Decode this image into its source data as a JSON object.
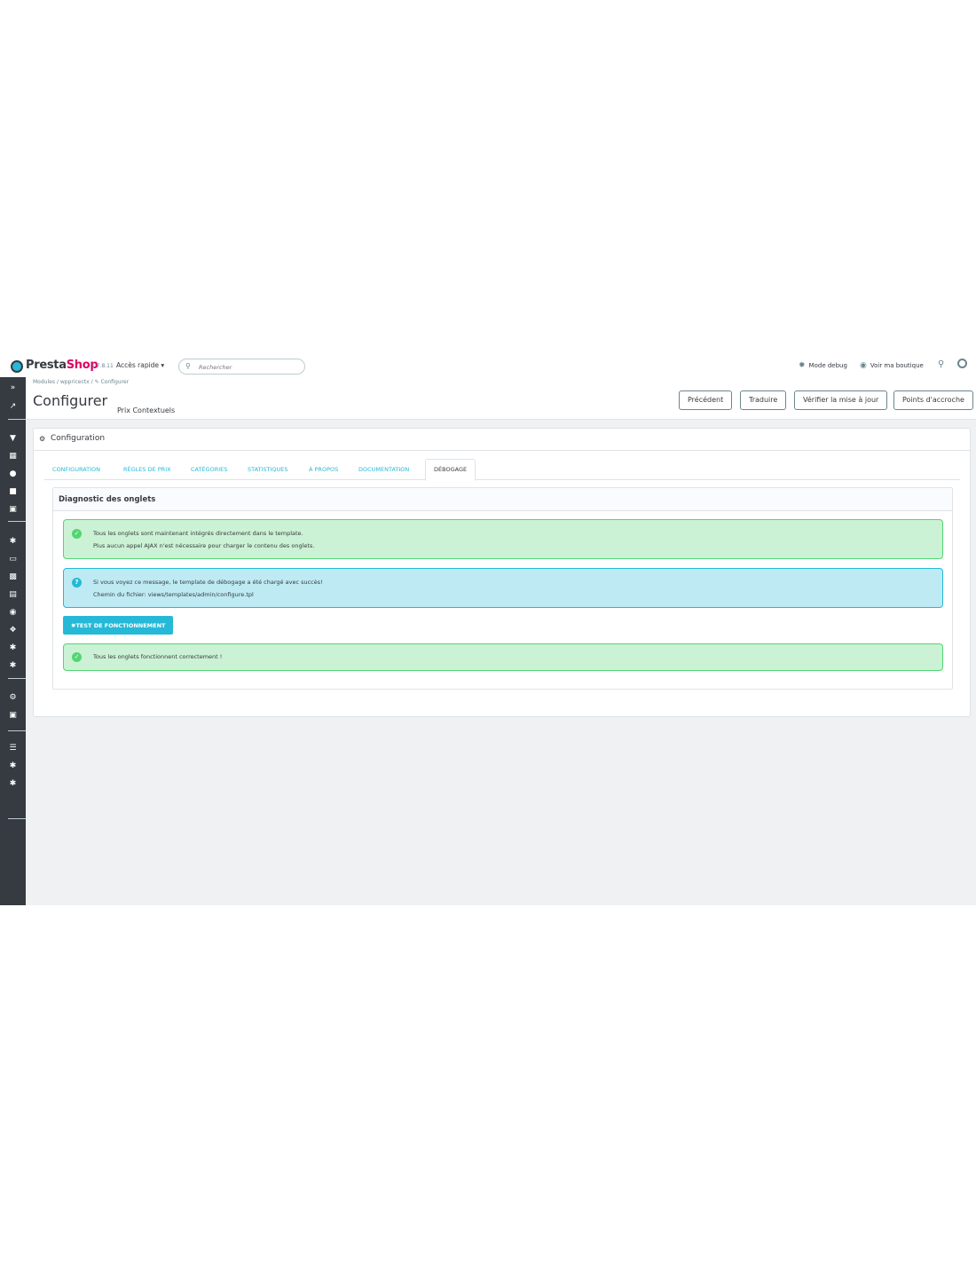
{
  "header": {
    "brand_presta": "Presta",
    "brand_shop": "Shop",
    "version": "1.7.8.11",
    "quick_access": "Accès rapide ▾",
    "search_placeholder": "Rechercher",
    "debug_mode": "Mode debug",
    "view_shop": "Voir ma boutique"
  },
  "breadcrumb": {
    "items": [
      "Modules",
      "wppricectx",
      "Configurer"
    ],
    "separator": "/"
  },
  "page": {
    "title": "Configurer",
    "subtitle": "Prix Contextuels"
  },
  "toolbar": {
    "previous": "Précédent",
    "translate": "Traduire",
    "check_update": "Vérifier la mise à jour",
    "hooks": "Points d'accroche"
  },
  "panel": {
    "title": "Configuration",
    "tabs": [
      {
        "label": "CONFIGURATION"
      },
      {
        "label": "RÈGLES DE PRIX"
      },
      {
        "label": "CATÉGORIES"
      },
      {
        "label": "STATISTIQUES"
      },
      {
        "label": "À PROPOS"
      },
      {
        "label": "DOCUMENTATION"
      },
      {
        "label": "DÉBOGAGE",
        "active": true
      }
    ]
  },
  "diagnostic": {
    "title": "Diagnostic des onglets",
    "success_line1": "Tous les onglets sont maintenant intégrés directement dans le template.",
    "success_line2": "Plus aucun appel AJAX n'est nécessaire pour charger le contenu des onglets.",
    "info_line1": "Si vous voyez ce message, le template de débogage a été chargé avec succès!",
    "info_line2": "Chemin du fichier: views/templates/admin/configure.tpl",
    "test_button": "TEST DE FONCTIONNEMENT",
    "result": "Tous les onglets fonctionnent correctement !"
  },
  "colors": {
    "primary": "#25b9d7",
    "brand_pink": "#df0067",
    "sidebar": "#363a41",
    "success_bg": "#cbf2d4",
    "info_bg": "#beeaf3"
  },
  "icons": {
    "logo": "prestashop-logo-icon",
    "search": "search-icon",
    "debug": "bug-icon",
    "view_shop": "eye-icon",
    "notifications": "bell-icon",
    "account": "user-circle-icon",
    "panel": "cogs-icon",
    "success": "check-circle-icon",
    "info": "question-circle-icon",
    "test": "bug-icon"
  }
}
